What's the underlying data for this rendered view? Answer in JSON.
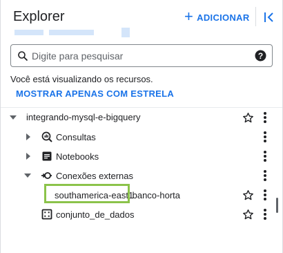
{
  "header": {
    "title": "Explorer",
    "add_label": "ADICIONAR"
  },
  "search": {
    "placeholder": "Digite para pesquisar",
    "value": ""
  },
  "info_text": "Você está visualizando os recursos.",
  "star_filter_label": "MOSTRAR APENAS COM ESTRELA",
  "tree": {
    "project": "integrando-mysql-e-bigquery",
    "consultas": "Consultas",
    "notebooks": "Notebooks",
    "conexoes": "Conexões externas",
    "connection_region": "southamerica-east1",
    "connection_name": ".banco-horta",
    "dataset": "conjunto_de_dados"
  },
  "colors": {
    "accent": "#1a73e8",
    "highlight": "#8bc34a",
    "icon": "#202124"
  },
  "icons": {
    "add": "plus-icon",
    "collapse": "collapse-panel-icon",
    "search": "search-icon",
    "help": "help-icon",
    "star": "star-outline-icon",
    "more": "more-vert-icon",
    "query": "query-icon",
    "notebook": "notebook-icon",
    "connection": "external-connection-icon",
    "dataset": "dataset-icon"
  }
}
